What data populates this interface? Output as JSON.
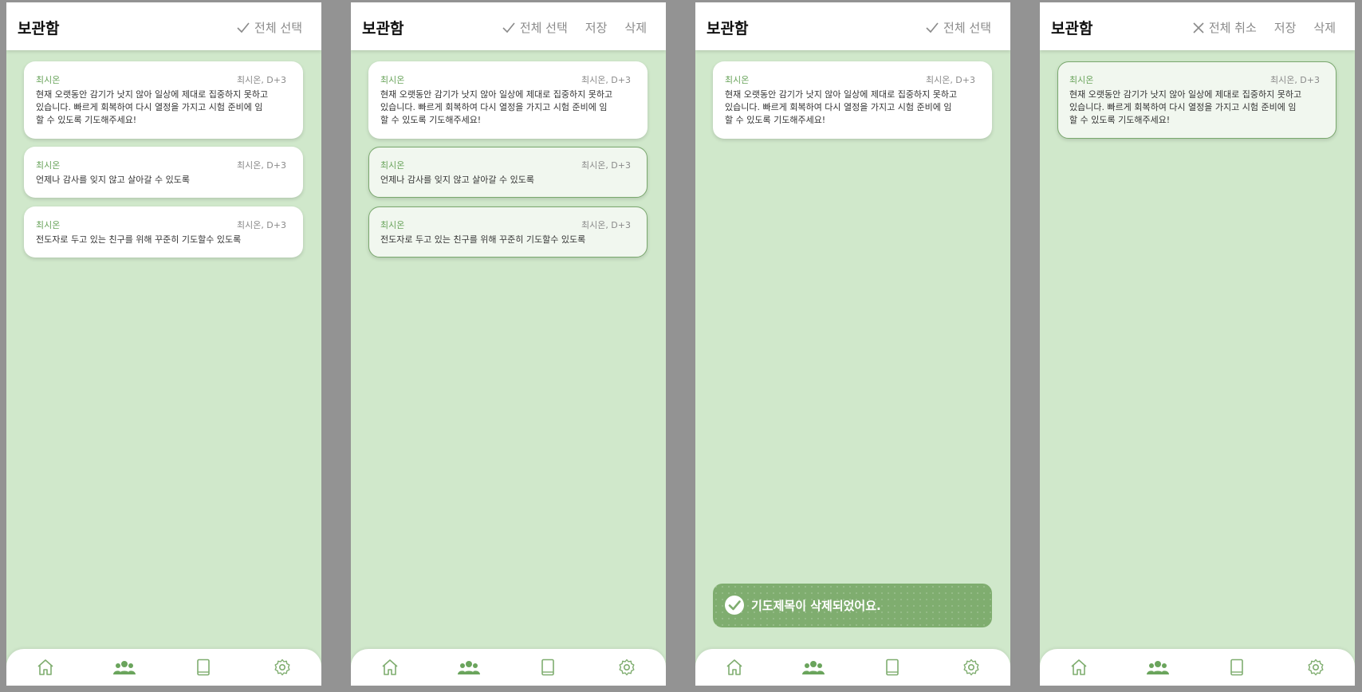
{
  "screens": [
    {
      "header": {
        "title": "보관함",
        "select_all": "전체 선택"
      },
      "cards": [
        {
          "author": "최시온",
          "meta": "최시온, D+3",
          "lines": [
            "현재 오랫동안 감기가 낫지 않아 일상에 제대로 집중하지 못하고",
            "있습니다. 빠르게 회복하여 다시 열정을 가지고 시험 준비에 임",
            "할 수 있도록 기도해주세요!"
          ]
        },
        {
          "author": "최시온",
          "meta": "최시온, D+3",
          "lines": [
            "언제나 감사를 잊지 않고 살아갈 수 있도록"
          ]
        },
        {
          "author": "최시온",
          "meta": "최시온, D+3",
          "lines": [
            "전도자로 두고 있는 친구를 위해 꾸준히 기도할수 있도록"
          ]
        }
      ]
    },
    {
      "header": {
        "title": "보관함",
        "select_all": "전체 선택",
        "save": "저장",
        "delete": "삭제"
      },
      "cards": [
        {
          "author": "최시온",
          "meta": "최시온, D+3",
          "lines": [
            "현재 오랫동안 감기가 낫지 않아 일상에 제대로 집중하지 못하고",
            "있습니다. 빠르게 회복하여 다시 열정을 가지고 시험 준비에 임",
            "할 수 있도록 기도해주세요!"
          ],
          "selected": false
        },
        {
          "author": "최시온",
          "meta": "최시온, D+3",
          "lines": [
            "언제나 감사를 잊지 않고 살아갈 수 있도록"
          ],
          "selected": true
        },
        {
          "author": "최시온",
          "meta": "최시온, D+3",
          "lines": [
            "전도자로 두고 있는 친구를 위해 꾸준히 기도할수 있도록"
          ],
          "selected": true
        }
      ]
    },
    {
      "header": {
        "title": "보관함",
        "select_all": "전체 선택"
      },
      "cards": [
        {
          "author": "최시온",
          "meta": "최시온, D+3",
          "lines": [
            "현재 오랫동안 감기가 낫지 않아 일상에 제대로 집중하지 못하고",
            "있습니다. 빠르게 회복하여 다시 열정을 가지고 시험 준비에 임",
            "할 수 있도록 기도해주세요!"
          ]
        }
      ],
      "toast": {
        "message": "기도제목이 삭제되었어요."
      }
    },
    {
      "header": {
        "title": "보관함",
        "deselect_all": "전체 취소",
        "save": "저장",
        "delete": "삭제"
      },
      "cards": [
        {
          "author": "최시온",
          "meta": "최시온, D+3",
          "lines": [
            "현재 오랫동안 감기가 낫지 않아 일상에 제대로 집중하지 못하고",
            "있습니다. 빠르게 회복하여 다시 열정을 가지고 시험 준비에 임",
            "할 수 있도록 기도해주세요!"
          ],
          "selected": true
        }
      ]
    }
  ],
  "tabbar_icons": [
    "home-icon",
    "community-icon",
    "book-icon",
    "settings-icon"
  ],
  "colors": {
    "background": "#d0e8cb",
    "accent": "#6aa45c",
    "toast": "#7fad6f",
    "selected_card": "#f1f7ef"
  }
}
